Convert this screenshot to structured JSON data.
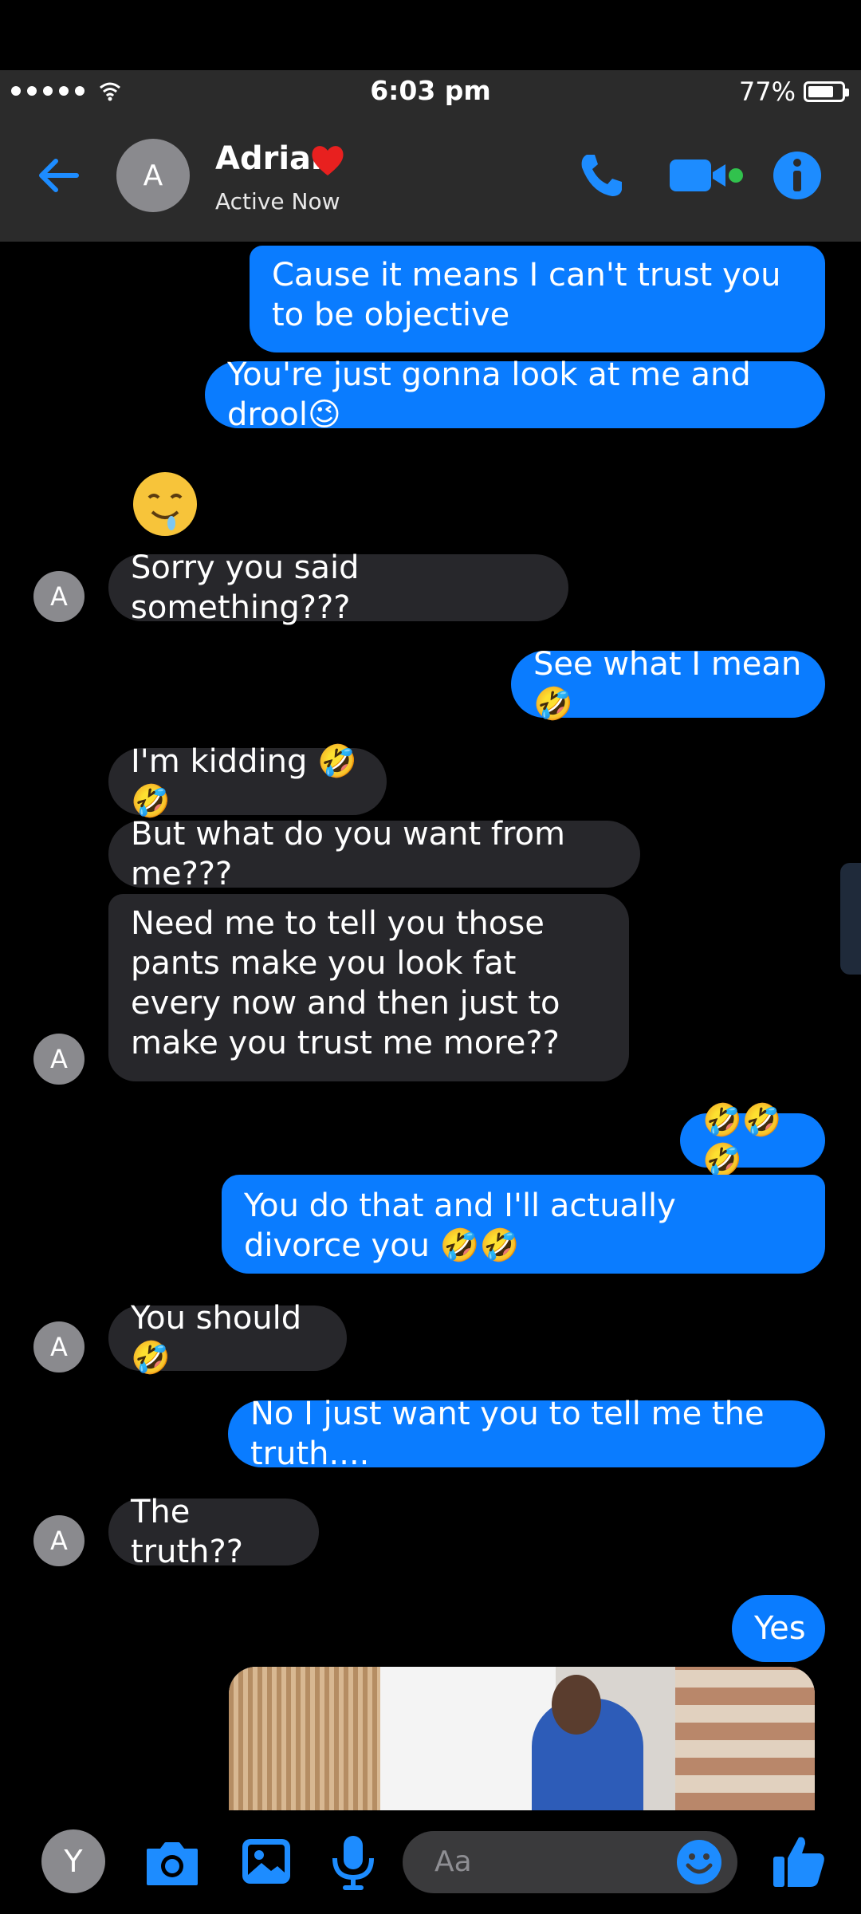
{
  "status": {
    "time": "6:03 pm",
    "battery": "77%",
    "battery_level": 0.77
  },
  "header": {
    "avatar_initial": "A",
    "contact_name": "Adrian",
    "status_text": "Active Now"
  },
  "messages": [
    {
      "from": "me",
      "text": "Cause it means I can't trust you to be objective"
    },
    {
      "from": "me",
      "text": "You're just gonna look at me and drool😉"
    },
    {
      "from": "them",
      "type": "emoji",
      "emoji": "drooling-face"
    },
    {
      "from": "them",
      "text": "Sorry you said something???"
    },
    {
      "from": "me",
      "text": "See what I mean🤣"
    },
    {
      "from": "them",
      "text": "I'm kidding 🤣🤣"
    },
    {
      "from": "them",
      "text": "But what do you want from me???"
    },
    {
      "from": "them",
      "text": "Need me to tell you those pants make you look fat every now and then just to make you trust me more??"
    },
    {
      "from": "me",
      "text": "🤣🤣🤣"
    },
    {
      "from": "me",
      "text": "You do that and I'll actually divorce you 🤣🤣"
    },
    {
      "from": "them",
      "text": "You should🤣"
    },
    {
      "from": "me",
      "text": "No I just want you to tell me the truth...."
    },
    {
      "from": "them",
      "text": "The truth??"
    },
    {
      "from": "me",
      "text": "Yes"
    },
    {
      "from": "me",
      "type": "photo"
    }
  ],
  "avatars": {
    "them": "A",
    "me": "Y"
  },
  "composer": {
    "placeholder": "Aa"
  },
  "colors": {
    "accent": "#0a7cff",
    "received_bubble": "#27272b",
    "header_bg": "#2b2b2b",
    "online": "#31c24d"
  },
  "icons": [
    "wifi-icon",
    "back-arrow-icon",
    "heart-icon",
    "phone-icon",
    "video-call-icon",
    "info-icon",
    "camera-icon",
    "gallery-icon",
    "microphone-icon",
    "emoji-smile-icon",
    "thumbs-up-icon"
  ]
}
